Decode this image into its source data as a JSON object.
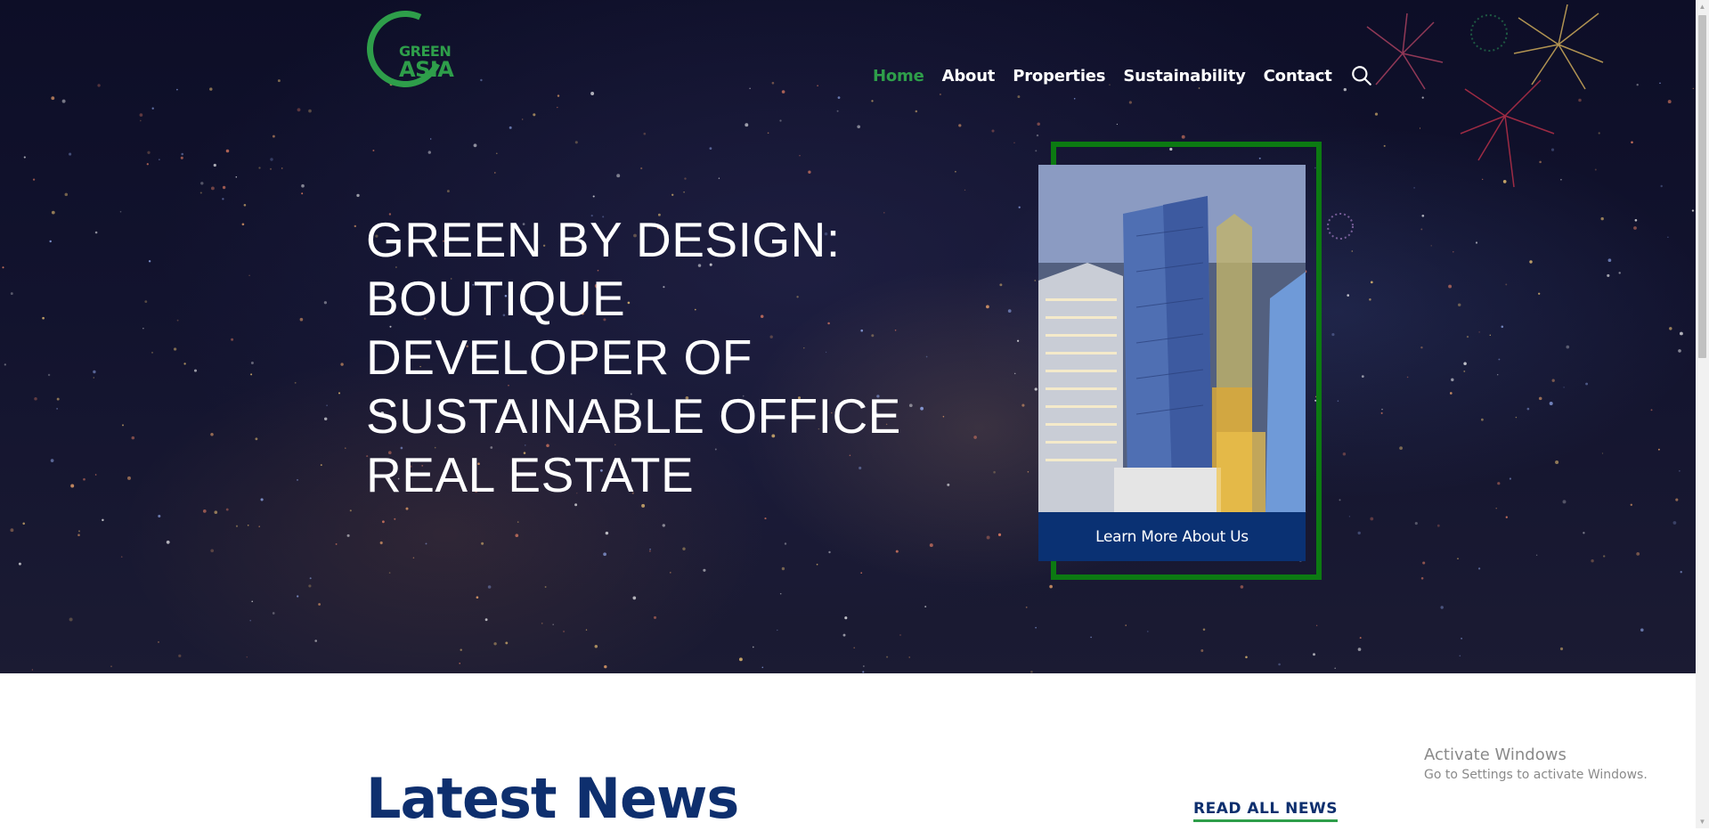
{
  "brand": {
    "logo_line1": "GREEN",
    "logo_line2": "ASIA"
  },
  "nav": {
    "items": [
      {
        "label": "Home",
        "active": true
      },
      {
        "label": "About",
        "active": false
      },
      {
        "label": "Properties",
        "active": false
      },
      {
        "label": "Sustainability",
        "active": false
      },
      {
        "label": "Contact",
        "active": false
      }
    ],
    "search_icon": "search-icon"
  },
  "hero": {
    "headline": "GREEN BY DESIGN: BOUTIQUE DEVELOPER OF SUSTAINABLE OFFICE REAL ESTATE",
    "cta_label": "Learn More About Us"
  },
  "news": {
    "title": "Latest News",
    "read_all_label": "READ ALL NEWS"
  },
  "watermark": {
    "title": "Activate Windows",
    "subtitle": "Go to Settings to activate Windows."
  },
  "colors": {
    "brand_green": "#2e9e4a",
    "frame_green": "#0c7a12",
    "navy": "#0a3173",
    "heading_navy": "#0e2f6e"
  }
}
